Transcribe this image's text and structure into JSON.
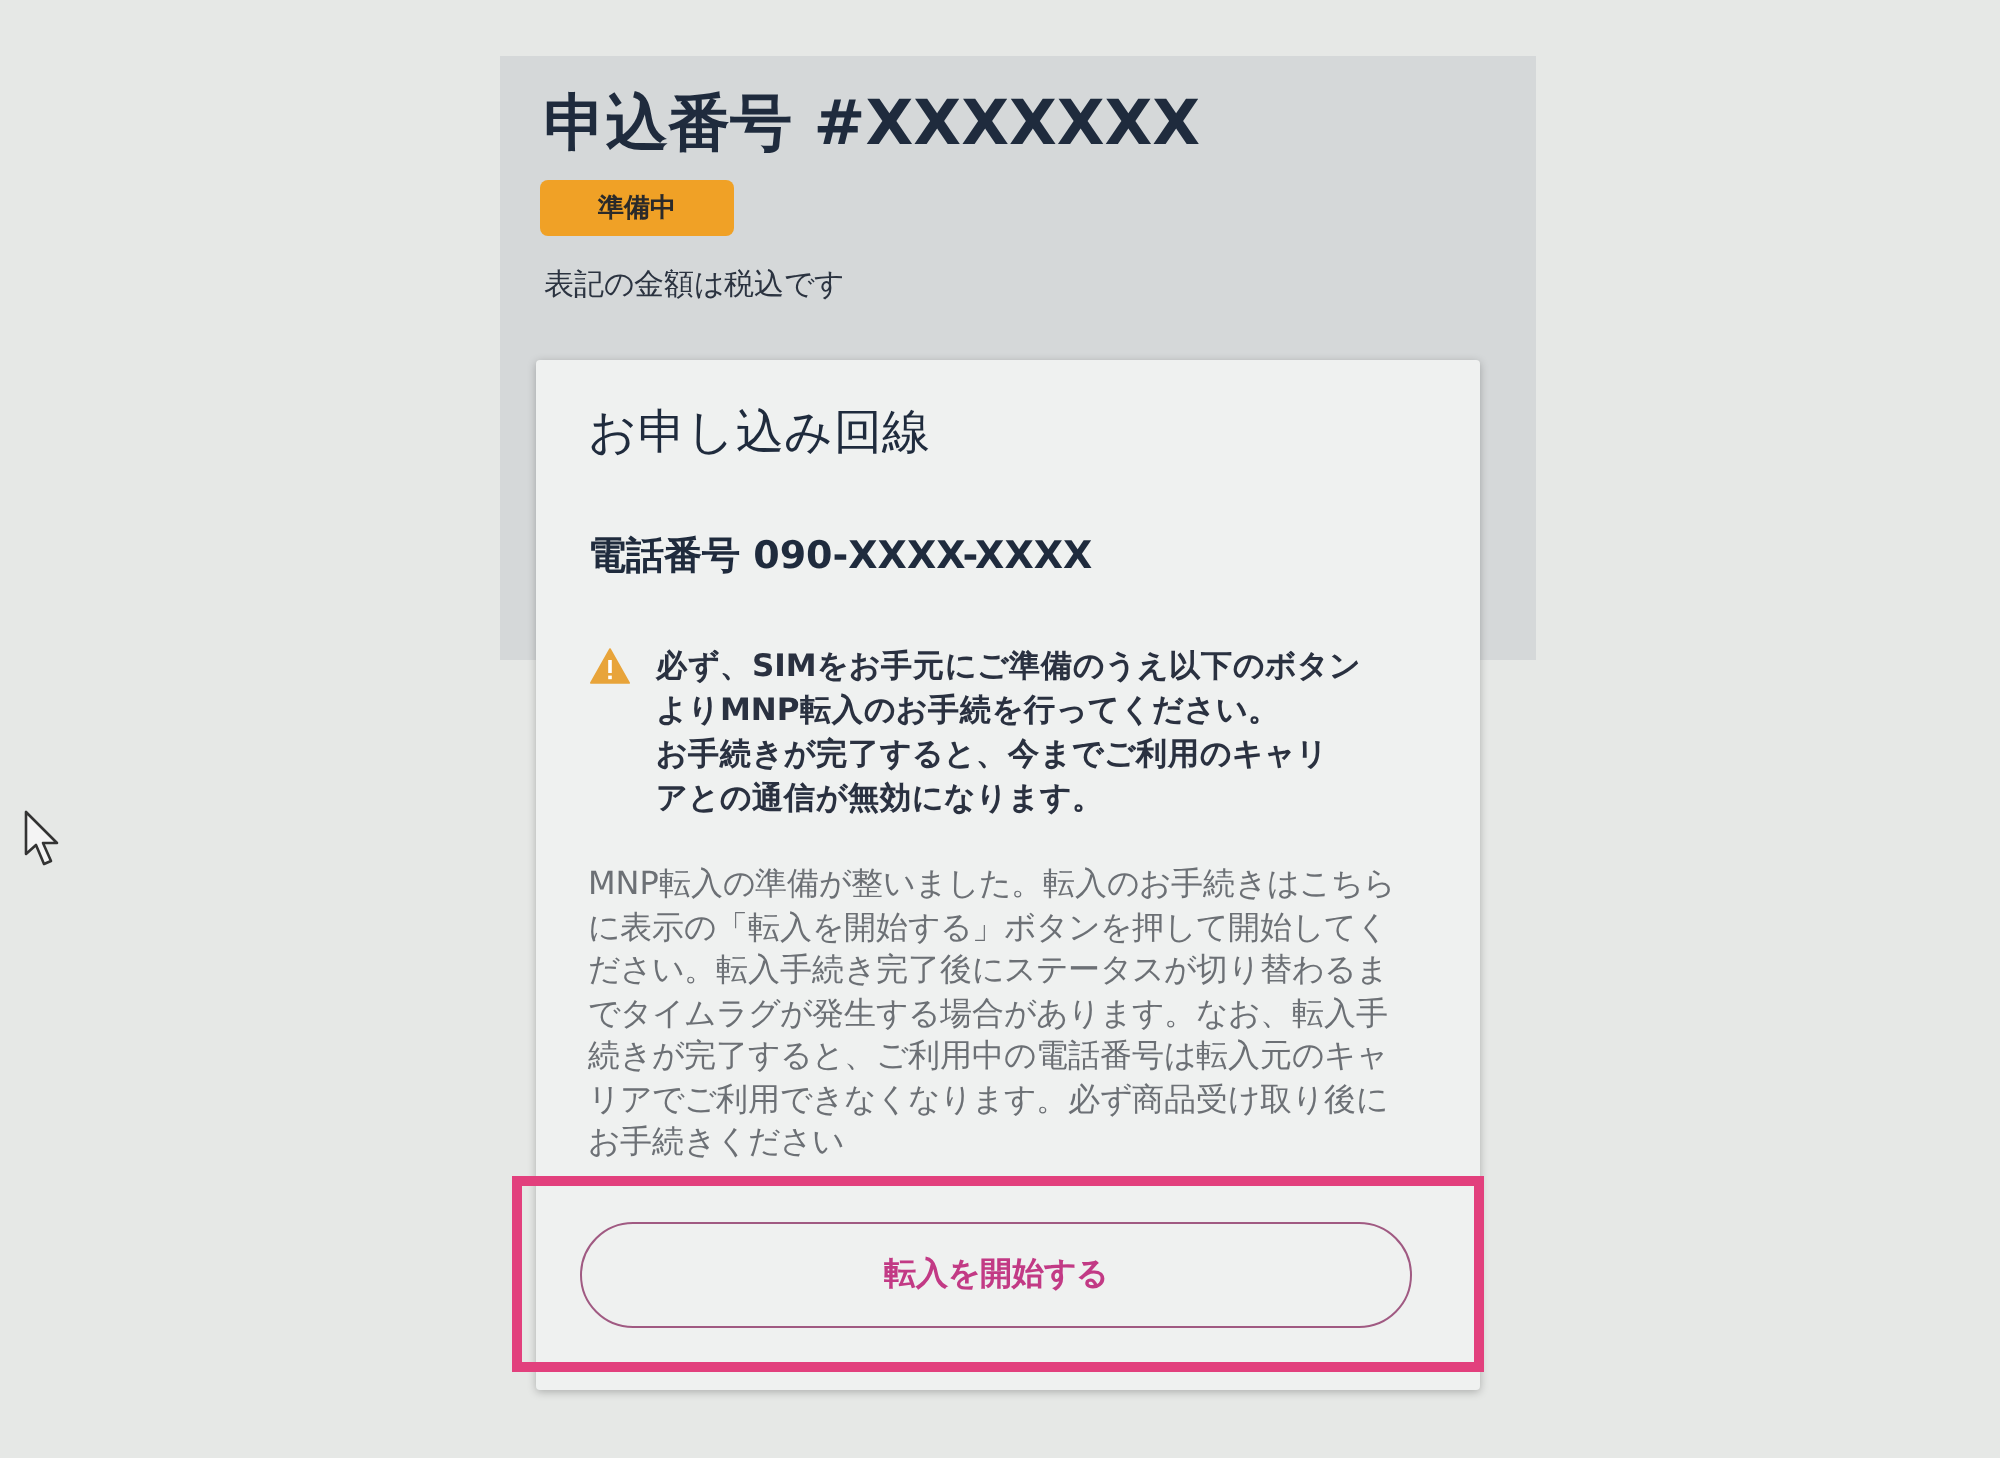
{
  "order": {
    "title": "申込番号 #XXXXXXX",
    "status_badge": "準備中",
    "tax_note": "表記の金額は税込です"
  },
  "line_card": {
    "title": "お申し込み回線",
    "phone": "電話番号 090-XXXX-XXXX",
    "warning": {
      "lines": [
        "必ず、SIMをお手元にご準備のうえ以下のボタン",
        "よりMNP転入のお手続を行ってください。",
        "お手続きが完了すると、今までご利用のキャリ",
        "アとの通信が無効になります。"
      ]
    },
    "description": {
      "lines": [
        "MNP転入の準備が整いました。転入のお手続きはこちら",
        "に表示の「転入を開始する」ボタンを押して開始してく",
        "ださい。転入手続き完了後にステータスが切り替わるま",
        "でタイムラグが発生する場合があります。なお、転入手",
        "続きが完了すると、ご利用中の電話番号は転入元のキャ",
        "リアでご利用できなくなります。必ず商品受け取り後に",
        "お手続きください"
      ]
    },
    "start_button": {
      "label": "転入を開始する",
      "highlighted": true
    }
  }
}
